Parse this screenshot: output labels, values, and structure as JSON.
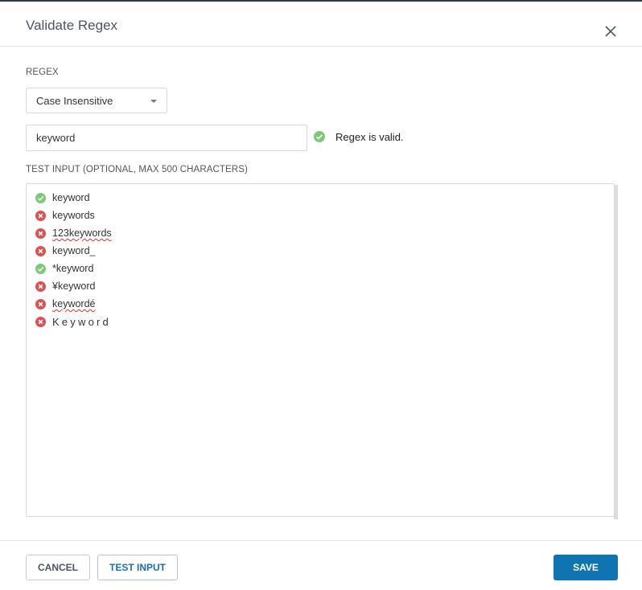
{
  "dialog": {
    "title": "Validate Regex",
    "close_icon": "close-icon"
  },
  "regex": {
    "label": "REGEX",
    "mode_selected": "Case Insensitive",
    "value": "keyword",
    "status_icon": "check-circle-icon",
    "status_text": "Regex is valid."
  },
  "test_input": {
    "label": "TEST INPUT (OPTIONAL, MAX 500 CHARACTERS)",
    "lines": [
      {
        "text": "keyword",
        "match": true
      },
      {
        "text": "keywords",
        "match": false
      },
      {
        "text": "123keywords",
        "match": false
      },
      {
        "text": "keyword_",
        "match": false
      },
      {
        "text": "*keyword",
        "match": true
      },
      {
        "text": "¥keyword",
        "match": false
      },
      {
        "text": "keywordé",
        "match": false
      },
      {
        "text": "Keyword",
        "match": false
      }
    ]
  },
  "footer": {
    "cancel_label": "CANCEL",
    "test_label": "TEST INPUT",
    "save_label": "SAVE"
  },
  "colors": {
    "match": "#7cc97a",
    "no_match": "#e05050",
    "primary": "#0f74b0"
  }
}
